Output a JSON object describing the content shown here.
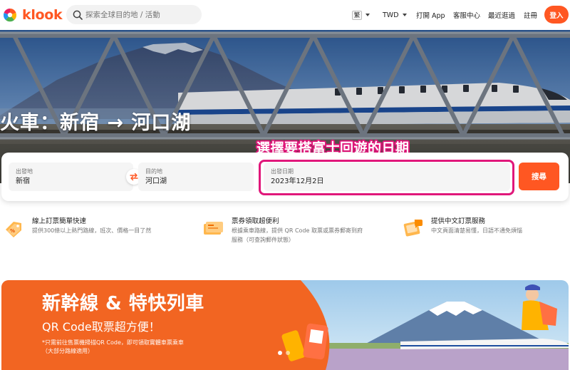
{
  "header": {
    "brand": "klook",
    "search_placeholder": "探索全球目的地 / 活動",
    "language": "繁",
    "currency": "TWD",
    "open_app": "打開 App",
    "help_center": "客服中心",
    "recently_viewed": "最近逛過",
    "signup": "註冊",
    "login": "登入"
  },
  "hero": {
    "title": "火車：新宿 → 河口湖",
    "annotation": "選擇要搭富士回遊的日期"
  },
  "booking": {
    "from_label": "出發地",
    "from_value": "新宿",
    "to_label": "目的地",
    "to_value": "河口湖",
    "date_label": "出發日期",
    "date_value": "2023年12月2日",
    "search_label": "搜尋"
  },
  "features": [
    {
      "title": "線上訂票簡單快速",
      "desc1": "提供300條以上熱門路線，班次、價格一目了然",
      "desc2": ""
    },
    {
      "title": "票券領取超便利",
      "desc1": "根據乘車路線，提供 QR Code 取票或票券郵寄到府",
      "desc2": "服務（可查詢郵件狀態）"
    },
    {
      "title": "提供中文訂票服務",
      "desc1": "中文頁面清楚易懂，日語不通免煩惱",
      "desc2": ""
    }
  ],
  "promo": {
    "title": "新幹線 & 特快列車",
    "subtitle": "QR Code取票超方便！",
    "note1": "*只需前往售票機掃描QR Code，即可領取實體車票乘車",
    "note2": "（大部分路線適用）"
  },
  "colors": {
    "brand": "#ff5722",
    "highlight": "#e0177a"
  }
}
